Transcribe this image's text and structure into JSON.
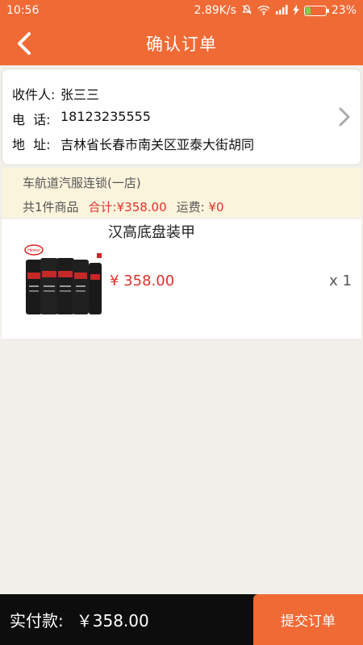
{
  "status_bar": {
    "time": "10:56",
    "speed": "2.89K/s",
    "battery": "23%"
  },
  "header": {
    "title": "确认订单"
  },
  "address": {
    "name_label": "收件人:",
    "name": "张三三",
    "phone_label": "电  话:",
    "phone": "18123235555",
    "addr_label": "地  址:",
    "addr": "吉林省长春市南关区亚泰大街胡同"
  },
  "store": {
    "name": "车航道汽服连锁(一店)",
    "count_text": "共1件商品",
    "subtotal_label": "合计:",
    "subtotal": "¥358.00",
    "shipping_label": "运费:",
    "shipping": "¥0"
  },
  "product": {
    "name": "汉高底盘装甲",
    "price": "¥ 358.00",
    "qty": "x 1",
    "brand": "Henkel"
  },
  "bottom": {
    "total_label": "实付款:",
    "total": "￥358.00",
    "submit_label": "提交订单"
  },
  "colors": {
    "accent": "#f06a35",
    "price": "#e0312c",
    "store_bg": "#fbf4dd",
    "bottom_bg": "#0d0d0d"
  }
}
